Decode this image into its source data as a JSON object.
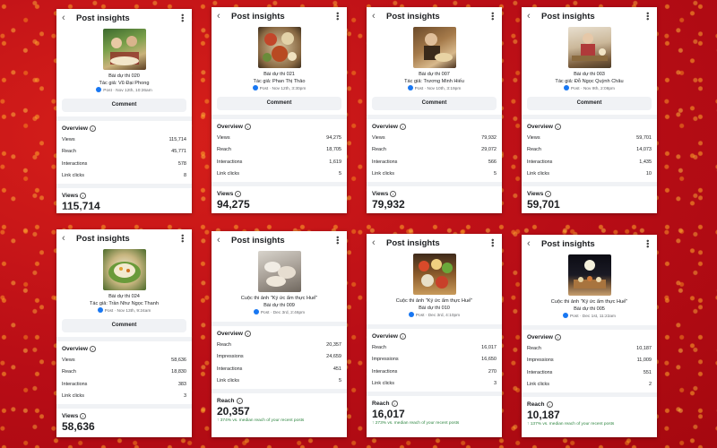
{
  "header_title": "Post insights",
  "comment_label": "Comment",
  "overview_label": "Overview",
  "delta_suffix": "vs. median reach of your recent posts",
  "cards": [
    {
      "entry": "Bài dự thi 020",
      "author": "Tác giả: Vũ Đại Phong",
      "post_meta": "Post · Nov 12th, 10:26am",
      "rows": [
        {
          "label": "Views",
          "value": "115,714"
        },
        {
          "label": "Reach",
          "value": "45,771"
        },
        {
          "label": "Interactions",
          "value": "578"
        },
        {
          "label": "Link clicks",
          "value": "8"
        }
      ],
      "big_label": "Views",
      "big_value": "115,714"
    },
    {
      "entry": "Bài dự thi 021",
      "author": "Tác giả: Phan Thị Thảo",
      "post_meta": "Post · Nov 12th, 3:30pm",
      "rows": [
        {
          "label": "Views",
          "value": "94,275"
        },
        {
          "label": "Reach",
          "value": "18,705"
        },
        {
          "label": "Interactions",
          "value": "1,619"
        },
        {
          "label": "Link clicks",
          "value": "5"
        }
      ],
      "big_label": "Views",
      "big_value": "94,275"
    },
    {
      "entry": "Bài dự thi 007",
      "author": "Tác giả: Trương Minh Hiếu",
      "post_meta": "Post · Nov 10th, 3:19pm",
      "rows": [
        {
          "label": "Views",
          "value": "79,932"
        },
        {
          "label": "Reach",
          "value": "29,072"
        },
        {
          "label": "Interactions",
          "value": "566"
        },
        {
          "label": "Link clicks",
          "value": "5"
        }
      ],
      "big_label": "Views",
      "big_value": "79,932"
    },
    {
      "entry": "Bài dự thi 003",
      "author": "Tác giả: Đỗ Ngọc Quỳnh Châu",
      "post_meta": "Post · Nov 9th, 2:08pm",
      "rows": [
        {
          "label": "Views",
          "value": "59,701"
        },
        {
          "label": "Reach",
          "value": "14,073"
        },
        {
          "label": "Interactions",
          "value": "1,435"
        },
        {
          "label": "Link clicks",
          "value": "10"
        }
      ],
      "big_label": "Views",
      "big_value": "59,701"
    },
    {
      "entry": "Bài dự thi 024",
      "author": "Tác giả: Trần Như Ngọc Thanh",
      "post_meta": "Post · Nov 13th, 9:24am",
      "rows": [
        {
          "label": "Views",
          "value": "58,636"
        },
        {
          "label": "Reach",
          "value": "18,830"
        },
        {
          "label": "Interactions",
          "value": "383"
        },
        {
          "label": "Link clicks",
          "value": "3"
        }
      ],
      "big_label": "Views",
      "big_value": "58,636"
    },
    {
      "contest": "Cuộc thi ảnh \"Ký ức ẩm thực Huế\"",
      "entry": "Bài dự thi 009",
      "post_meta": "Post · Dec 3rd, 2:46pm",
      "rows": [
        {
          "label": "Reach",
          "value": "20,357"
        },
        {
          "label": "Impressions",
          "value": "24,659"
        },
        {
          "label": "Interactions",
          "value": "451"
        },
        {
          "label": "Link clicks",
          "value": "5"
        }
      ],
      "big_label": "Reach",
      "big_value": "20,357",
      "delta": "↑ 374%"
    },
    {
      "contest": "Cuộc thi ảnh \"Ký ức ẩm thực Huế\"",
      "entry": "Bài dự thi 010",
      "post_meta": "Post · Dec 3rd, 4:10pm",
      "rows": [
        {
          "label": "Reach",
          "value": "16,017"
        },
        {
          "label": "Impressions",
          "value": "16,650"
        },
        {
          "label": "Interactions",
          "value": "270"
        },
        {
          "label": "Link clicks",
          "value": "3"
        }
      ],
      "big_label": "Reach",
      "big_value": "16,017",
      "delta": "↑ 273%"
    },
    {
      "contest": "Cuộc thi ảnh \"Ký ức ẩm thực Huế\"",
      "entry": "Bài dự thi 005",
      "post_meta": "Post · Dec 1st, 11:22am",
      "rows": [
        {
          "label": "Reach",
          "value": "10,187"
        },
        {
          "label": "Impressions",
          "value": "11,009"
        },
        {
          "label": "Interactions",
          "value": "551"
        },
        {
          "label": "Link clicks",
          "value": "2"
        }
      ],
      "big_label": "Reach",
      "big_value": "10,187",
      "delta": "↑ 137%"
    }
  ]
}
